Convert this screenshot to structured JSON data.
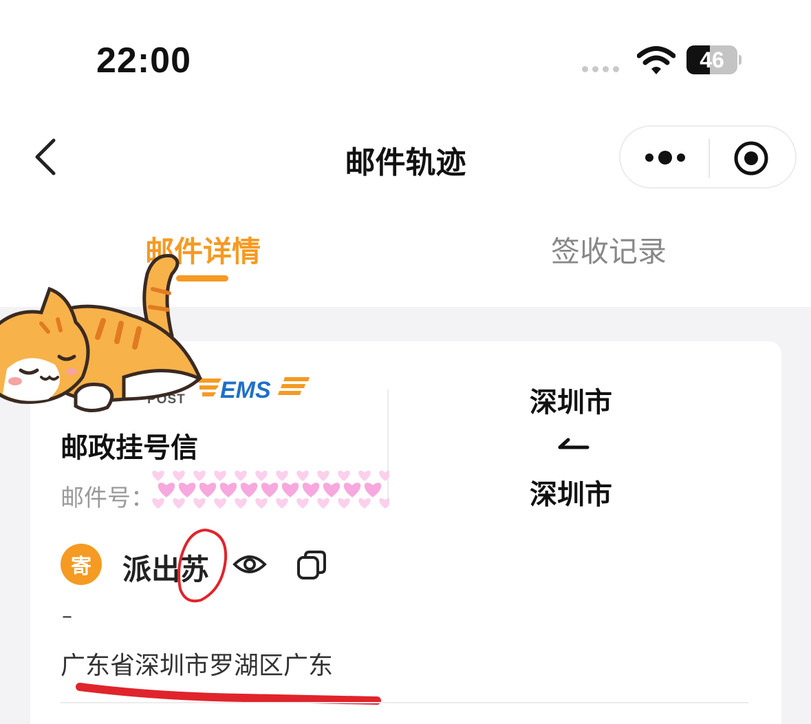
{
  "status_bar": {
    "time": "22:00",
    "battery_level": "46",
    "battery_fraction": 0.46,
    "icons": [
      "signal-dots-icon",
      "wifi-icon",
      "battery-icon"
    ]
  },
  "nav": {
    "title": "邮件轨迹",
    "back_icon": "chevron-left-icon",
    "more_icon": "more-dots-icon",
    "close_icon": "target-circle-icon"
  },
  "tabs": [
    {
      "label": "邮件详情",
      "active": true
    },
    {
      "label": "签收记录",
      "active": false
    }
  ],
  "card": {
    "carrier_logo_text": "EMS",
    "carrier_sub_text": "POST",
    "mail_type": "邮政挂号信",
    "tracking_label": "邮件号：",
    "route": {
      "from": "深圳市",
      "to": "深圳市"
    },
    "sender": {
      "badge": "寄",
      "name": "派出苏",
      "dash": "–",
      "address": "广东省深圳市罗湖区广东"
    }
  },
  "colors": {
    "accent": "#f59a23",
    "annotation_red": "#e0242b",
    "content_bg": "#f3f3f5",
    "ems_blue": "#1f6fc9"
  }
}
